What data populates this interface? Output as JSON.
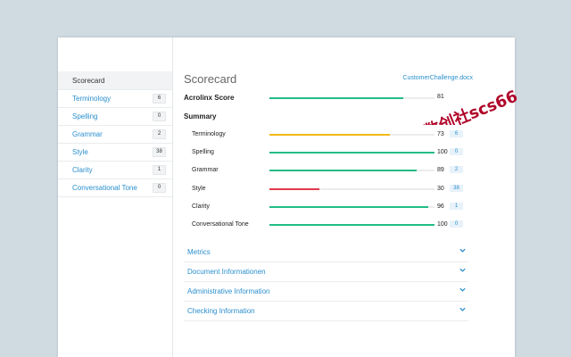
{
  "sidebar": {
    "items": [
      {
        "label": "Scorecard",
        "badge": ""
      },
      {
        "label": "Terminology",
        "badge": "6"
      },
      {
        "label": "Spelling",
        "badge": "0"
      },
      {
        "label": "Grammar",
        "badge": "2"
      },
      {
        "label": "Style",
        "badge": "38"
      },
      {
        "label": "Clarity",
        "badge": "1"
      },
      {
        "label": "Conversational Tone",
        "badge": "0"
      }
    ]
  },
  "main": {
    "title": "Scorecard",
    "document_link": "CustomerChallenge.docx",
    "acrolinx_score": {
      "label": "Acrolinx Score",
      "value": "81",
      "fraction": 0.81,
      "color": "#22bd85"
    },
    "summary_title": "Summary",
    "summary_rows": [
      {
        "label": "Terminology",
        "value": "73",
        "badge": "6",
        "fraction": 0.73,
        "color": "#f5b914"
      },
      {
        "label": "Spelling",
        "value": "100",
        "badge": "0",
        "fraction": 1.0,
        "color": "#22bd85"
      },
      {
        "label": "Grammar",
        "value": "89",
        "badge": "2",
        "fraction": 0.89,
        "color": "#22bd85"
      },
      {
        "label": "Style",
        "value": "30",
        "badge": "38",
        "fraction": 0.3,
        "color": "#e2394e"
      },
      {
        "label": "Clarity",
        "value": "96",
        "badge": "1",
        "fraction": 0.96,
        "color": "#22bd85"
      },
      {
        "label": "Conversational Tone",
        "value": "100",
        "badge": "0",
        "fraction": 1.0,
        "color": "#22bd85"
      }
    ],
    "accordions": [
      {
        "label": "Metrics",
        "icon": "chevron-down-icon"
      },
      {
        "label": "Document Informationen",
        "icon": "chevron-down-icon"
      },
      {
        "label": "Administrative Information",
        "icon": "chevron-down-icon"
      },
      {
        "label": "Checking Information",
        "icon": "chevron-down-icon"
      }
    ]
  },
  "watermark": {
    "text": "数创社scs66"
  }
}
